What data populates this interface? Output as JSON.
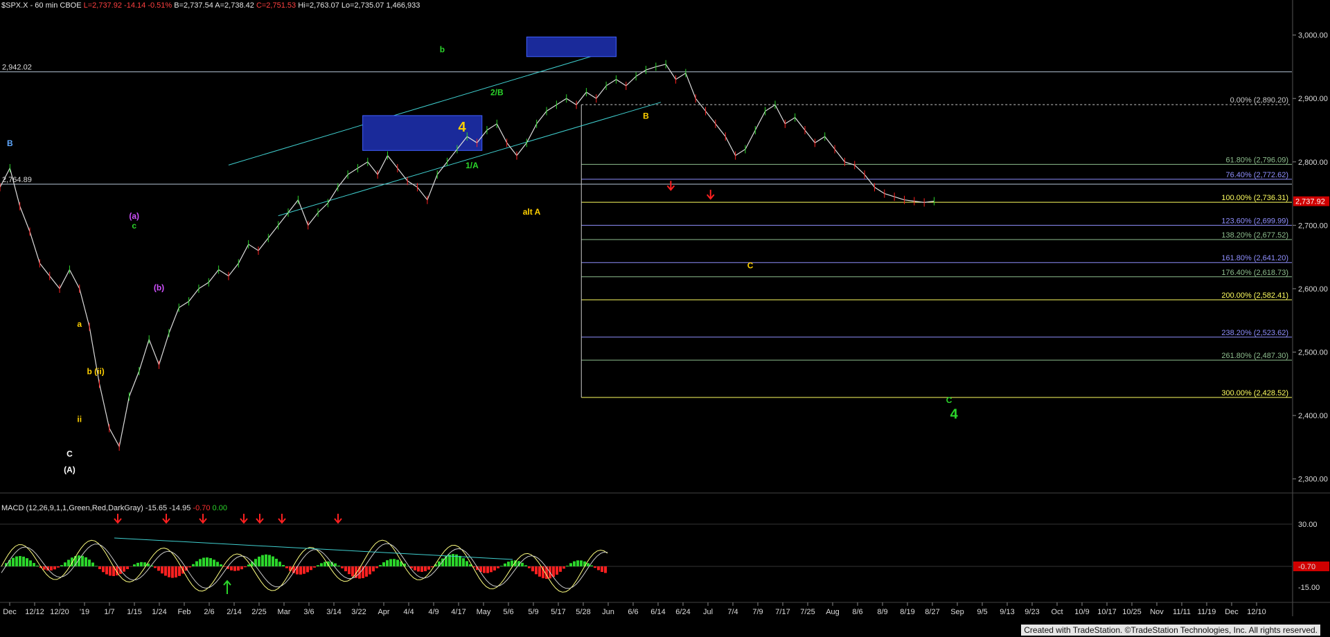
{
  "header": {
    "symbol": "$SPX.X - 60 min  CBOE",
    "last": "L=2,737.92",
    "change": "-14.14",
    "pct": "-0.51%",
    "bid": "B=2,737.54",
    "ask": "A=2,738.42",
    "close": "C=2,751.53",
    "high": "Hi=2,763.07",
    "low": "Lo=2,735.07",
    "volume": "1,466,933"
  },
  "macd": {
    "label": "MACD (12,26,9,1,1,Green,Red,DarkGray)",
    "v1": "-15.65",
    "v2": "-14.95",
    "v3": "-0.70",
    "v4": "0.00",
    "ticks": [
      "30.00",
      "-0.70",
      "-15.00"
    ]
  },
  "footer": "Created with TradeStation. ©TradeStation Technologies, Inc. All rights reserved.",
  "colors": {
    "up": "#2bd52b",
    "down": "#ff2020",
    "text": "#ddd",
    "grid": "#2a2a2a"
  },
  "chart_data": {
    "type": "line",
    "title": "$SPX.X - 60 min",
    "ylim": [
      2280,
      3040
    ],
    "y_ticks": [
      3000,
      2900,
      2800,
      2700,
      2600,
      2500,
      2400,
      2300
    ],
    "y_tick_labels": [
      "3,000.00",
      "2,900.00",
      "2,800.00",
      "2,700.00",
      "2,600.00",
      "2,500.00",
      "2,400.00",
      "2,300.00"
    ],
    "x_tick_labels": [
      "Dec",
      "12/12",
      "12/20",
      "'19",
      "1/7",
      "1/15",
      "1/24",
      "Feb",
      "2/6",
      "2/14",
      "2/25",
      "Mar",
      "3/6",
      "3/14",
      "3/22",
      "Apr",
      "4/4",
      "4/9",
      "4/17",
      "May",
      "5/6",
      "5/9",
      "5/17",
      "5/28",
      "Jun",
      "6/6",
      "6/14",
      "6/24",
      "Jul",
      "7/4",
      "7/9",
      "7/17",
      "7/25",
      "Aug",
      "8/6",
      "8/9",
      "8/19",
      "8/27",
      "Sep",
      "9/5",
      "9/13",
      "9/23",
      "Oct",
      "10/9",
      "10/17",
      "10/25",
      "Nov",
      "11/11",
      "11/19",
      "Dec",
      "12/10"
    ],
    "last_price": 2737.92,
    "last_price_label": "2,737.92",
    "series": [
      {
        "x": [
          0,
          2,
          4,
          6,
          8,
          10,
          12,
          14,
          16,
          18,
          20,
          22,
          24,
          26,
          28,
          30,
          32,
          34,
          36,
          38,
          40,
          42,
          44,
          46,
          48,
          50,
          52,
          54,
          56,
          58,
          60,
          62,
          64,
          66,
          68,
          70,
          72,
          74,
          76,
          78,
          80,
          82,
          84,
          86,
          88,
          90,
          92,
          94,
          96,
          98,
          100,
          102,
          104,
          106,
          108,
          110,
          112,
          114,
          116,
          118,
          120,
          122,
          124,
          126,
          128,
          130,
          132,
          134,
          136,
          138,
          140,
          142,
          144,
          146,
          148,
          150,
          152,
          154,
          156,
          158,
          160,
          162,
          164,
          166,
          168,
          170,
          172,
          174,
          176,
          178,
          180,
          182,
          184,
          186,
          188
        ],
        "y": [
          2760,
          2790,
          2730,
          2690,
          2640,
          2620,
          2600,
          2630,
          2600,
          2540,
          2450,
          2380,
          2351,
          2430,
          2470,
          2520,
          2480,
          2530,
          2570,
          2580,
          2600,
          2610,
          2630,
          2620,
          2640,
          2670,
          2660,
          2680,
          2700,
          2720,
          2740,
          2700,
          2720,
          2735,
          2760,
          2780,
          2790,
          2800,
          2780,
          2810,
          2790,
          2770,
          2760,
          2740,
          2780,
          2800,
          2820,
          2840,
          2830,
          2850,
          2860,
          2830,
          2810,
          2830,
          2860,
          2880,
          2890,
          2900,
          2890,
          2910,
          2900,
          2920,
          2930,
          2920,
          2935,
          2945,
          2950,
          2954,
          2930,
          2940,
          2900,
          2880,
          2860,
          2840,
          2810,
          2820,
          2850,
          2880,
          2890,
          2860,
          2870,
          2850,
          2830,
          2840,
          2820,
          2800,
          2795,
          2780,
          2760,
          2750,
          2745,
          2740,
          2738,
          2736,
          2738
        ]
      }
    ],
    "horizontal_lines": [
      {
        "value": 2942.02,
        "label": "2,942.02"
      },
      {
        "value": 2764.89,
        "label": "2,764.89"
      }
    ],
    "fib_levels": [
      {
        "label": "0.00% (2,890.20)",
        "value": 2890.2
      },
      {
        "label": "61.80% (2,796.09)",
        "value": 2796.09
      },
      {
        "label": "76.40% (2,772.62)",
        "value": 2772.62
      },
      {
        "label": "100.00% (2,736.31)",
        "value": 2736.31
      },
      {
        "label": "123.60% (2,699.99)",
        "value": 2699.99
      },
      {
        "label": "138.20% (2,677.52)",
        "value": 2677.52
      },
      {
        "label": "161.80% (2,641.20)",
        "value": 2641.2
      },
      {
        "label": "176.40% (2,618.73)",
        "value": 2618.73
      },
      {
        "label": "200.00% (2,582.41)",
        "value": 2582.41
      },
      {
        "label": "238.20% (2,523.62)",
        "value": 2523.62
      },
      {
        "label": "261.80% (2,487.30)",
        "value": 2487.3
      },
      {
        "label": "300.00% (2,428.52)",
        "value": 2428.52
      }
    ],
    "wave_labels": [
      {
        "text": "B",
        "x": 2,
        "y": 2825,
        "color": "#5fa8ff"
      },
      {
        "text": "C",
        "x": 14,
        "y": 2335,
        "color": "#ffffff"
      },
      {
        "text": "(A)",
        "x": 14,
        "y": 2310,
        "color": "#ffffff"
      },
      {
        "text": "a",
        "x": 16,
        "y": 2540,
        "color": "#ffd000"
      },
      {
        "text": "b",
        "x": 18,
        "y": 2465,
        "color": "#ffd000"
      },
      {
        "text": "ii",
        "x": 16,
        "y": 2390,
        "color": "#ffd000"
      },
      {
        "text": "(ii)",
        "x": 20,
        "y": 2465,
        "color": "#ffd000"
      },
      {
        "text": "(a)",
        "x": 27,
        "y": 2710,
        "color": "#d050ff"
      },
      {
        "text": "c",
        "x": 27,
        "y": 2695,
        "color": "#2bd52b"
      },
      {
        "text": "(b)",
        "x": 32,
        "y": 2597,
        "color": "#d050ff"
      },
      {
        "text": "b",
        "x": 89,
        "y": 2973,
        "color": "#2bd52b"
      },
      {
        "text": "2/B",
        "x": 100,
        "y": 2905,
        "color": "#2bd52b"
      },
      {
        "text": "1/A",
        "x": 95,
        "y": 2790,
        "color": "#2bd52b"
      },
      {
        "text": "4",
        "x": 93,
        "y": 2848,
        "color": "#ffd000"
      },
      {
        "text": "alt A",
        "x": 107,
        "y": 2717,
        "color": "#ffd000"
      },
      {
        "text": "B",
        "x": 130,
        "y": 2868,
        "color": "#ffd000"
      },
      {
        "text": "C",
        "x": 151,
        "y": 2632,
        "color": "#ffd000"
      },
      {
        "text": "C",
        "x": 191,
        "y": 2420,
        "color": "#2bd52b"
      },
      {
        "text": "4",
        "x": 192,
        "y": 2395,
        "color": "#2bd52b"
      }
    ]
  }
}
